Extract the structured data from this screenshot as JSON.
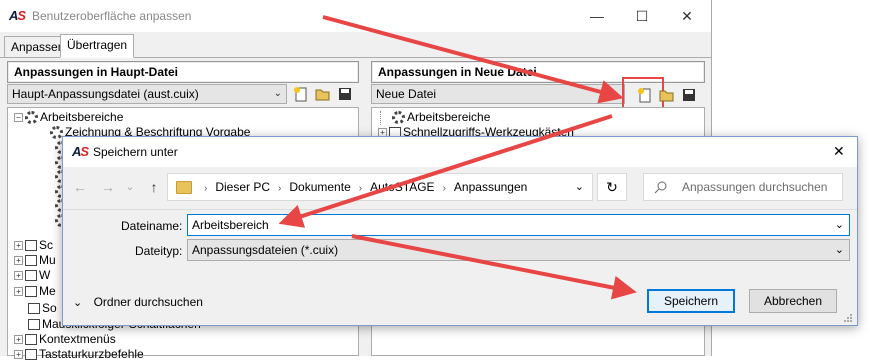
{
  "main_window": {
    "title": "Benutzeroberfläche anpassen",
    "logo_a": "A",
    "logo_s": "S",
    "controls": {
      "minimize": "—",
      "maximize": "☐",
      "close": "✕"
    },
    "tabs": [
      {
        "label": "Anpassen"
      },
      {
        "label": "Übertragen"
      }
    ],
    "left_panel": {
      "heading": "Anpassungen in Haupt-Datei",
      "combo_value": "Haupt-Anpassungsdatei (aust.cuix)",
      "tree": [
        {
          "label": "Arbeitsbereiche"
        },
        {
          "label": "Zeichnung & Beschriftung Vorgabe"
        },
        {
          "label": "Sc"
        },
        {
          "label": "Mu"
        },
        {
          "label": "W"
        },
        {
          "label": "Me"
        },
        {
          "label": "So"
        },
        {
          "label": "Mausklickfolger-Schaltflächen"
        },
        {
          "label": "Kontextmenüs"
        },
        {
          "label": "Tastaturkurzbefehle"
        }
      ]
    },
    "right_panel": {
      "heading": "Anpassungen in Neue Datei",
      "combo_value": "Neue Datei",
      "tree": [
        {
          "label": "Arbeitsbereiche"
        },
        {
          "label": "Schnellzugriffs-Werkzeugkästen"
        }
      ]
    },
    "combo_arrow": "⌄"
  },
  "dialog": {
    "title": "Speichern unter",
    "close": "✕",
    "nav": {
      "back": "←",
      "forward": "→",
      "dropdown": "⌄",
      "up": "↑"
    },
    "breadcrumb": [
      "Dieser PC",
      "Dokumente",
      "AutoSTAGE",
      "Anpassungen"
    ],
    "breadcrumb_sep": "›",
    "address_dropdown": "⌄",
    "refresh": "↻",
    "search_placeholder": "Anpassungen durchsuchen",
    "filename_label": "Dateiname:",
    "filename_value": "Arbeitsbereich",
    "filetype_label": "Dateityp:",
    "filetype_value": "Anpassungsdateien (*.cuix)",
    "browse_folders": "Ordner durchsuchen",
    "browse_chevron": "⌄",
    "save_button": "Speichern",
    "cancel_button": "Abbrechen",
    "dropdown_arrow": "⌄"
  },
  "colors": {
    "annotation_arrow": "#e84545",
    "accent": "#0078d7"
  }
}
